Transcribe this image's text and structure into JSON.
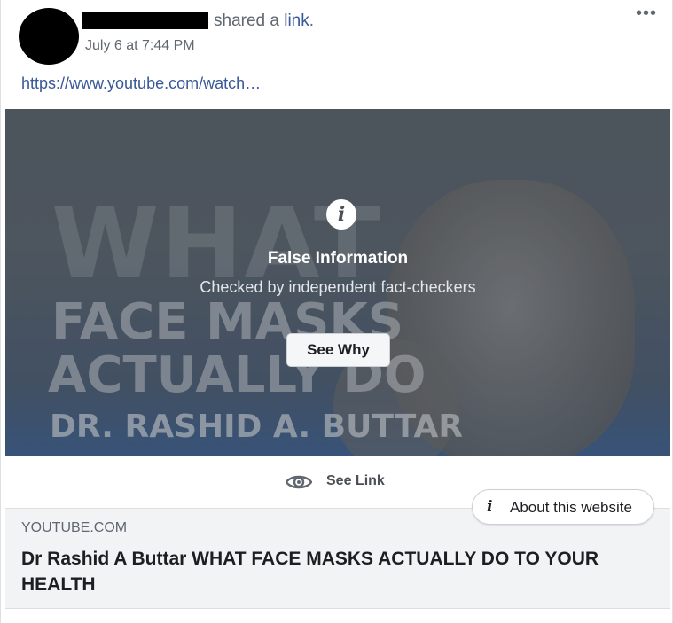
{
  "post": {
    "action_prefix": "shared a ",
    "action_link": "link",
    "action_suffix": ".",
    "timestamp": "July 6 at 7:44 PM",
    "menu_glyph": "•••",
    "url": "https://www.youtube.com/watch…"
  },
  "media": {
    "bg_word": "WHAT",
    "bg_line1": "FACE MASKS",
    "bg_line2": "ACTUALLY DO",
    "bg_line3": "DR. RASHID A. BUTTAR"
  },
  "fact_check": {
    "icon": "info-icon",
    "icon_glyph": "i",
    "title": "False Information",
    "subtitle": "Checked by independent fact-checkers",
    "button": "See Why"
  },
  "see_link": {
    "icon": "eye-icon",
    "label": "See Link"
  },
  "about": {
    "icon": "info-icon",
    "icon_glyph": "i",
    "label": "About this website"
  },
  "preview": {
    "domain": "YOUTUBE.COM",
    "headline": "Dr Rashid A Buttar WHAT FACE MASKS ACTUALLY DO TO YOUR HEALTH"
  },
  "colors": {
    "link": "#385898",
    "overlay": "#596069",
    "meta_text": "#606770"
  }
}
